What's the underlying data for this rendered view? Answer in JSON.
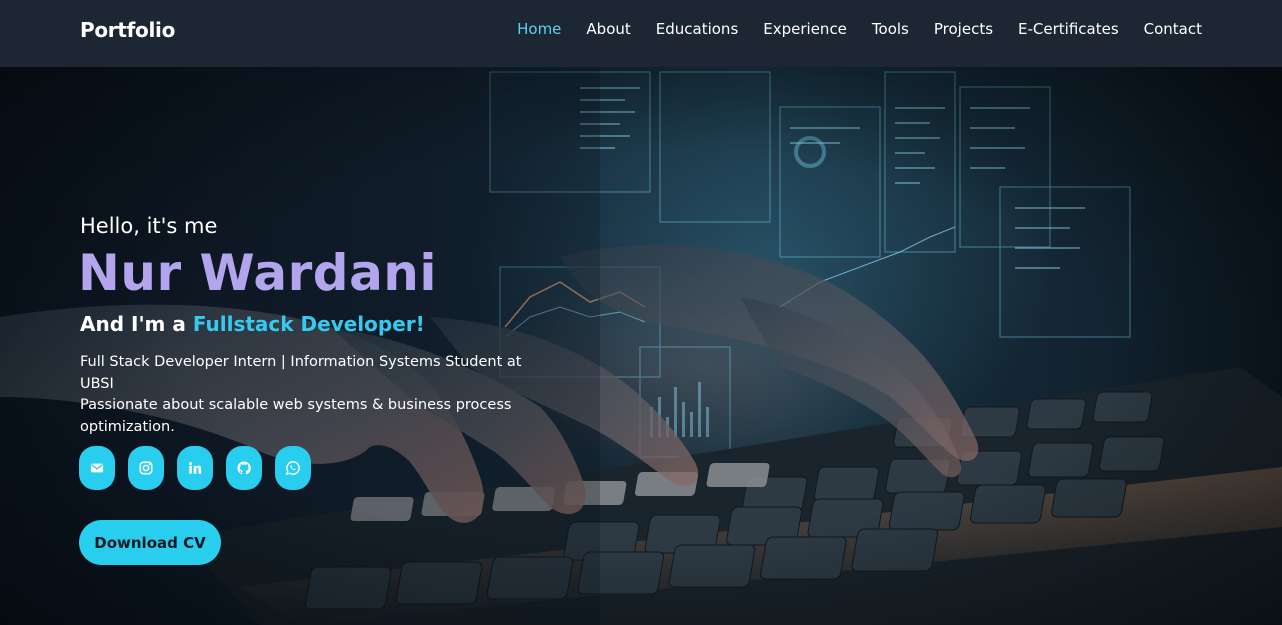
{
  "header": {
    "logo": "Portfolio",
    "nav": [
      {
        "label": "Home",
        "active": true
      },
      {
        "label": "About"
      },
      {
        "label": "Educations"
      },
      {
        "label": "Experience"
      },
      {
        "label": "Tools"
      },
      {
        "label": "Projects"
      },
      {
        "label": "E-Certificates"
      },
      {
        "label": "Contact"
      }
    ]
  },
  "hero": {
    "greeting": "Hello, it's me",
    "name": "Nur Wardani",
    "role_prefix": "And I'm a ",
    "role": "Fullstack Developer!",
    "description_line1": "Full Stack Developer Intern | Information Systems Student at UBSI",
    "description_line2": "Passionate about scalable web systems & business process optimization.",
    "socials": [
      "email-icon",
      "instagram-icon",
      "linkedin-icon",
      "github-icon",
      "whatsapp-icon"
    ],
    "cv_button": "Download CV"
  },
  "colors": {
    "accent": "#29cdee",
    "name": "#b3a4ee",
    "header_bg": "#1d2733"
  }
}
